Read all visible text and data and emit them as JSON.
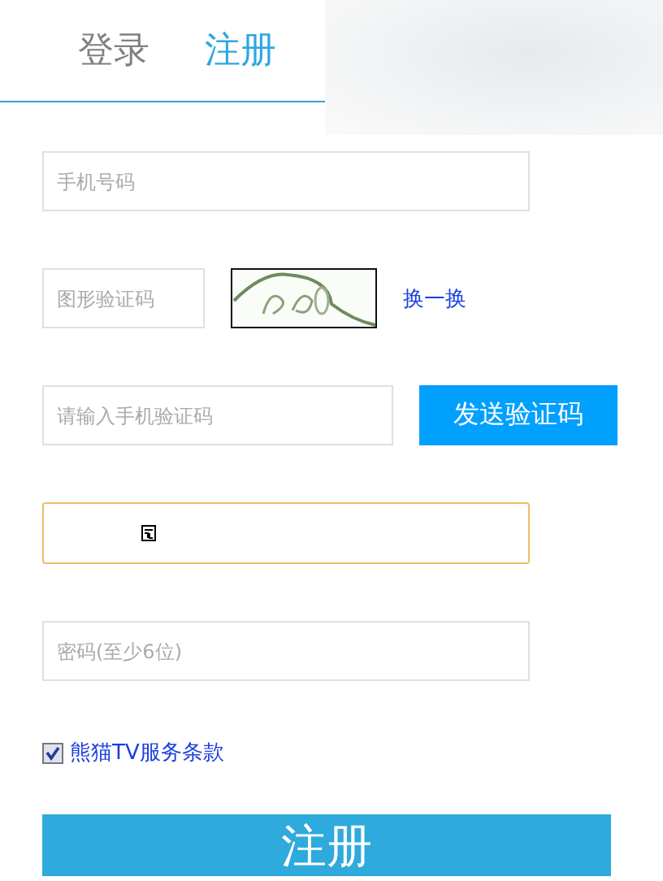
{
  "tabs": [
    {
      "label": "登录",
      "selected": false
    },
    {
      "label": "注册",
      "selected": true
    }
  ],
  "phone": {
    "placeholder": "手机号码"
  },
  "captcha": {
    "placeholder": "图形验证码",
    "refresh": "换一换"
  },
  "sms": {
    "placeholder": "请输入手机验证码",
    "button": "发送验证码"
  },
  "focused_field": {
    "focused": true
  },
  "password": {
    "placeholder": "密码(至少6位)"
  },
  "terms": {
    "label": "熊猫TV服务条款",
    "checked": true
  },
  "submit": "注册"
}
